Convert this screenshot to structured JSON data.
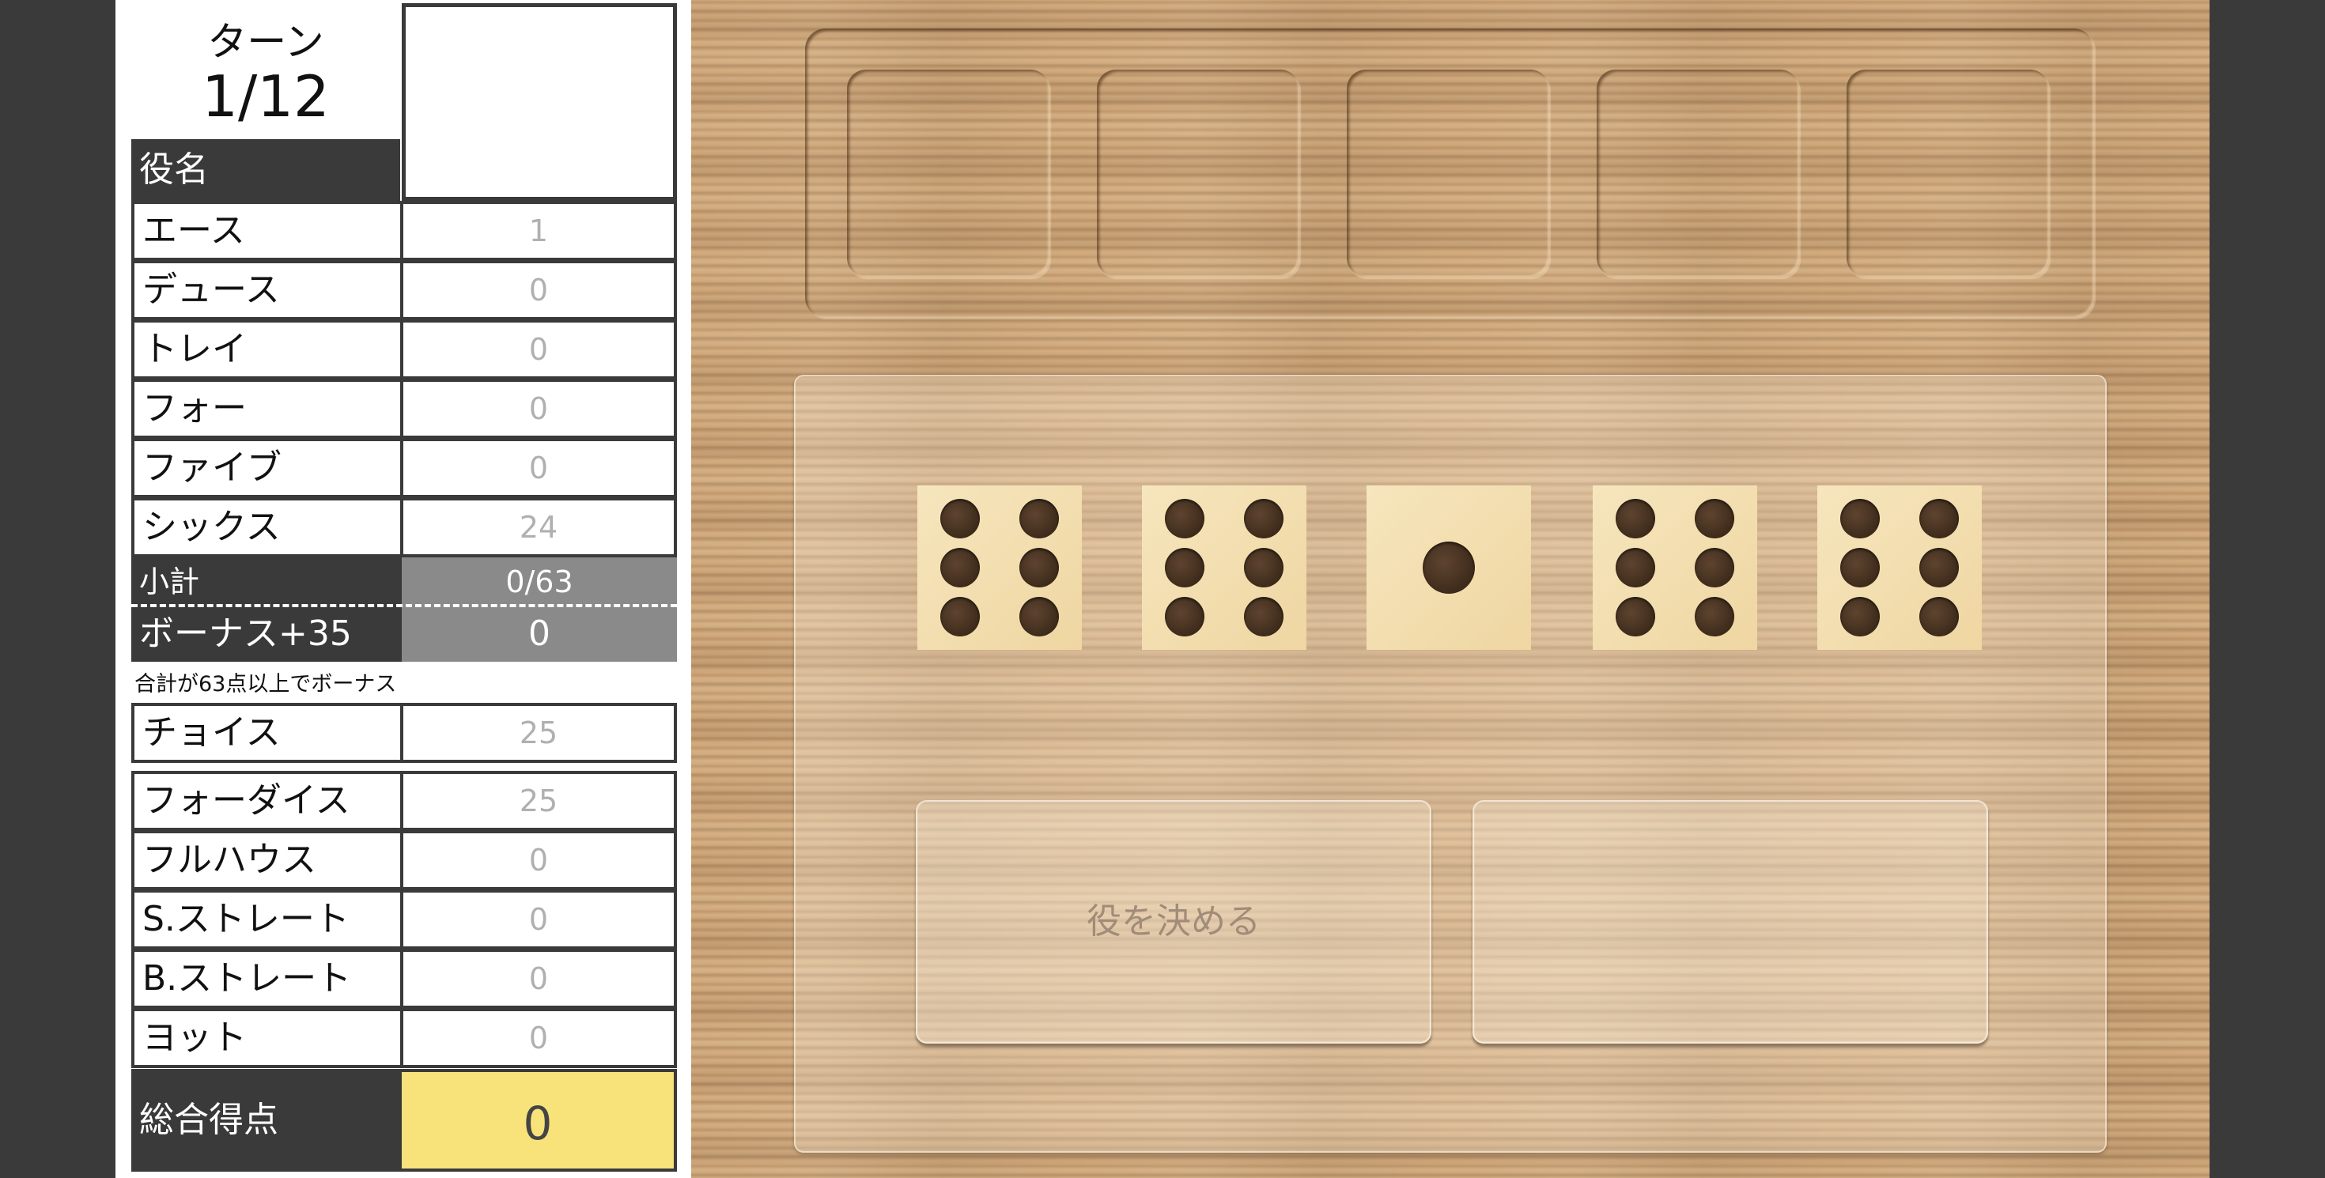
{
  "turn": {
    "label": "ターン",
    "value": "1/12"
  },
  "sheet": {
    "header": "役名",
    "upper": [
      {
        "name": "エース",
        "value": "1"
      },
      {
        "name": "デュース",
        "value": "0"
      },
      {
        "name": "トレイ",
        "value": "0"
      },
      {
        "name": "フォー",
        "value": "0"
      },
      {
        "name": "ファイブ",
        "value": "0"
      },
      {
        "name": "シックス",
        "value": "24"
      }
    ],
    "subtotal": {
      "name": "小計",
      "value": "0/63"
    },
    "bonus": {
      "name": "ボーナス+35",
      "value": "0"
    },
    "bonus_note": "合計が63点以上でボーナス",
    "choice": {
      "name": "チョイス",
      "value": "25"
    },
    "lower": [
      {
        "name": "フォーダイス",
        "value": "25"
      },
      {
        "name": "フルハウス",
        "value": "0"
      },
      {
        "name": "S.ストレート",
        "value": "0"
      },
      {
        "name": "B.ストレート",
        "value": "0"
      },
      {
        "name": "ヨット",
        "value": "0"
      }
    ],
    "total": {
      "name": "総合得点",
      "value": "0"
    }
  },
  "board": {
    "held_slots": 5,
    "dice": [
      6,
      6,
      1,
      6,
      6
    ],
    "decide_button": "役を決める",
    "roll_button": ""
  },
  "colors": {
    "frame": "#3a3a3a",
    "total_highlight": "#f8e27a",
    "subtotal_bg": "#8a8a8a",
    "score_text": "#b0b0b0"
  }
}
